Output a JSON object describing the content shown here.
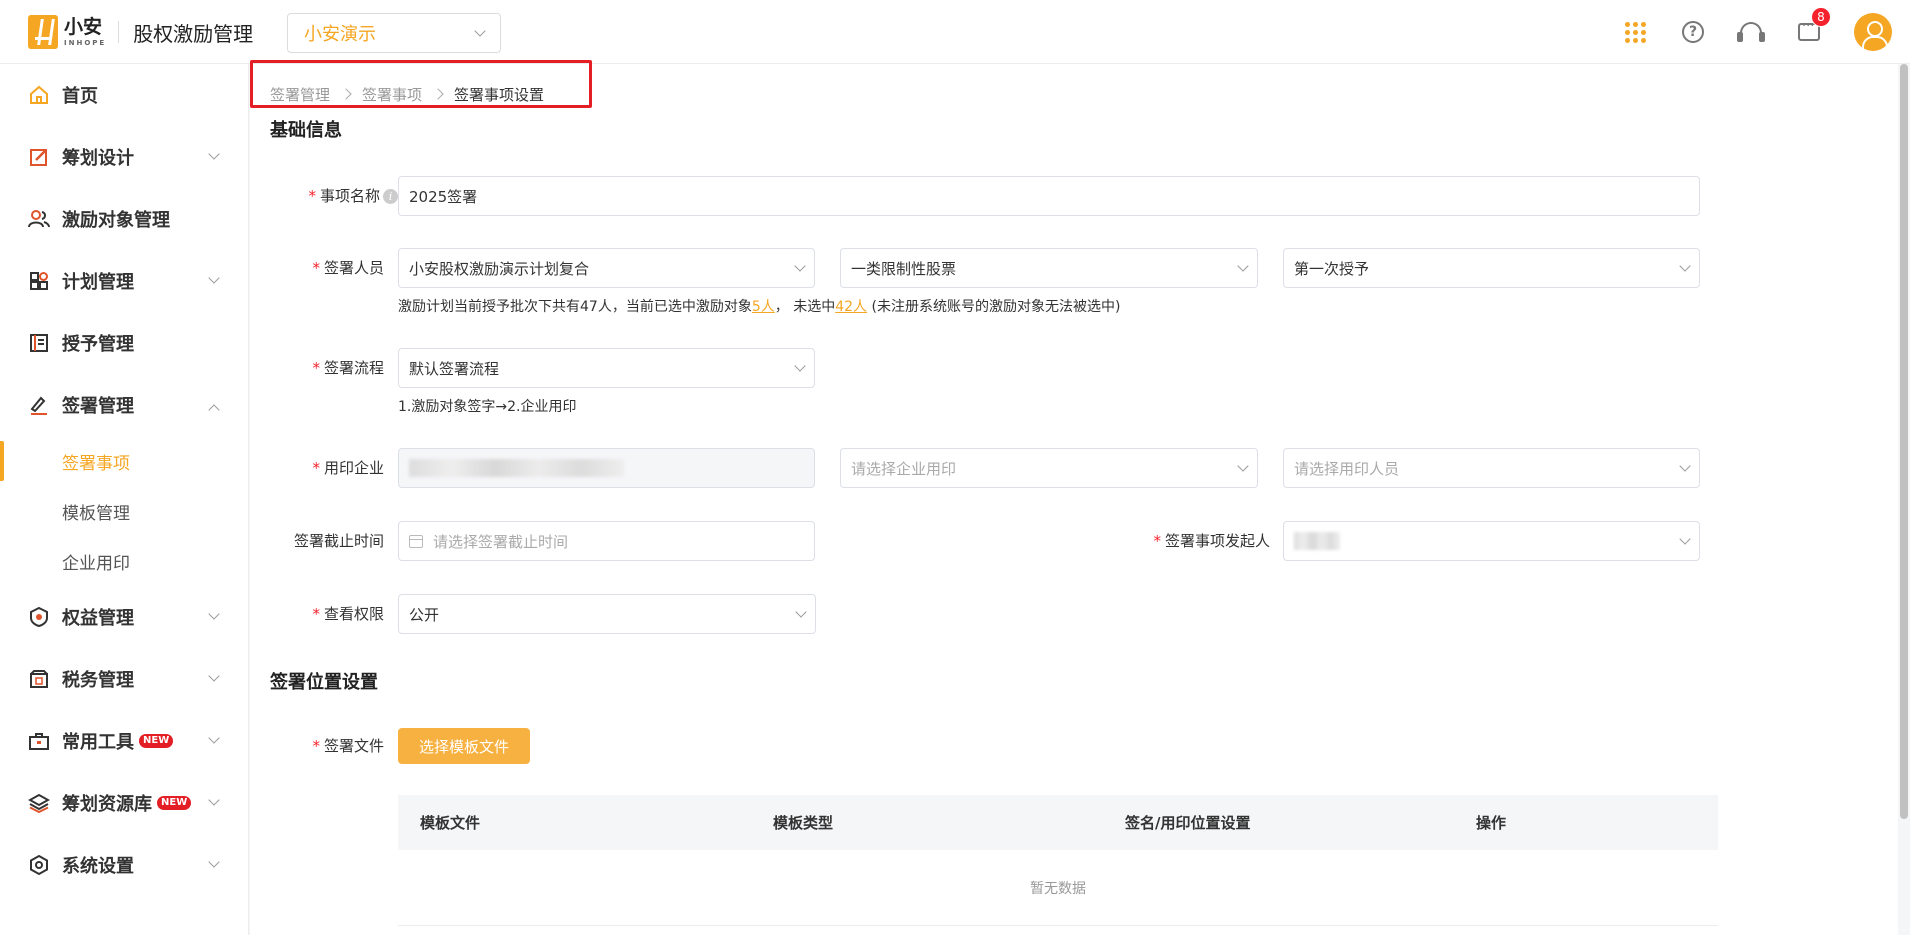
{
  "header": {
    "logo_cn": "小安",
    "logo_en": "INHOPE",
    "app_title": "股权激励管理",
    "company_select": "小安演示",
    "notification_count": "8"
  },
  "sidebar": {
    "items": [
      {
        "label": "首页",
        "icon": "home-icon"
      },
      {
        "label": "筹划设计",
        "icon": "edit-icon"
      },
      {
        "label": "激励对象管理",
        "icon": "users-icon"
      },
      {
        "label": "计划管理",
        "icon": "grid-icon"
      },
      {
        "label": "授予管理",
        "icon": "book-icon"
      },
      {
        "label": "签署管理",
        "icon": "sign-icon"
      },
      {
        "label": "权益管理",
        "icon": "badge-icon"
      },
      {
        "label": "税务管理",
        "icon": "tax-icon"
      },
      {
        "label": "常用工具",
        "icon": "toolbox-icon",
        "tag": "NEW"
      },
      {
        "label": "筹划资源库",
        "icon": "layers-icon",
        "tag": "NEW"
      },
      {
        "label": "系统设置",
        "icon": "settings-icon"
      }
    ],
    "sub_items": [
      "签署事项",
      "模板管理",
      "企业用印"
    ]
  },
  "breadcrumb": [
    "签署管理",
    "签署事项",
    "签署事项设置"
  ],
  "basic_info": {
    "title": "基础信息",
    "item_name_label": "事项名称",
    "item_name_value": "2025签署",
    "signers_label": "签署人员",
    "signers_plan": "小安股权激励演示计划复合",
    "signers_type": "一类限制性股票",
    "signers_batch": "第一次授予",
    "signers_hint_pre": "激励计划当前授予批次下共有47人，当前已选中激励对象",
    "signers_selected": "5人",
    "signers_hint_mid": "， 未选中",
    "signers_unselected": "42人",
    "signers_hint_post": " (未注册系统账号的激励对象无法被选中)",
    "flow_label": "签署流程",
    "flow_value": "默认签署流程",
    "flow_hint": "1.激励对象签字→2.企业用印",
    "seal_company_label": "用印企业",
    "seal_select_placeholder": "请选择企业用印",
    "seal_person_placeholder": "请选择用印人员",
    "deadline_label": "签署截止时间",
    "deadline_placeholder": "请选择签署截止时间",
    "initiator_label": "签署事项发起人",
    "permission_label": "查看权限",
    "permission_value": "公开"
  },
  "position_settings": {
    "title": "签署位置设置",
    "file_label": "签署文件",
    "select_button": "选择模板文件",
    "columns": [
      "模板文件",
      "模板类型",
      "签名/用印位置设置",
      "操作"
    ],
    "empty_text": "暂无数据"
  },
  "colors": {
    "accent": "#f5a623",
    "required": "#f5222d",
    "highlight": "#e31e24"
  }
}
